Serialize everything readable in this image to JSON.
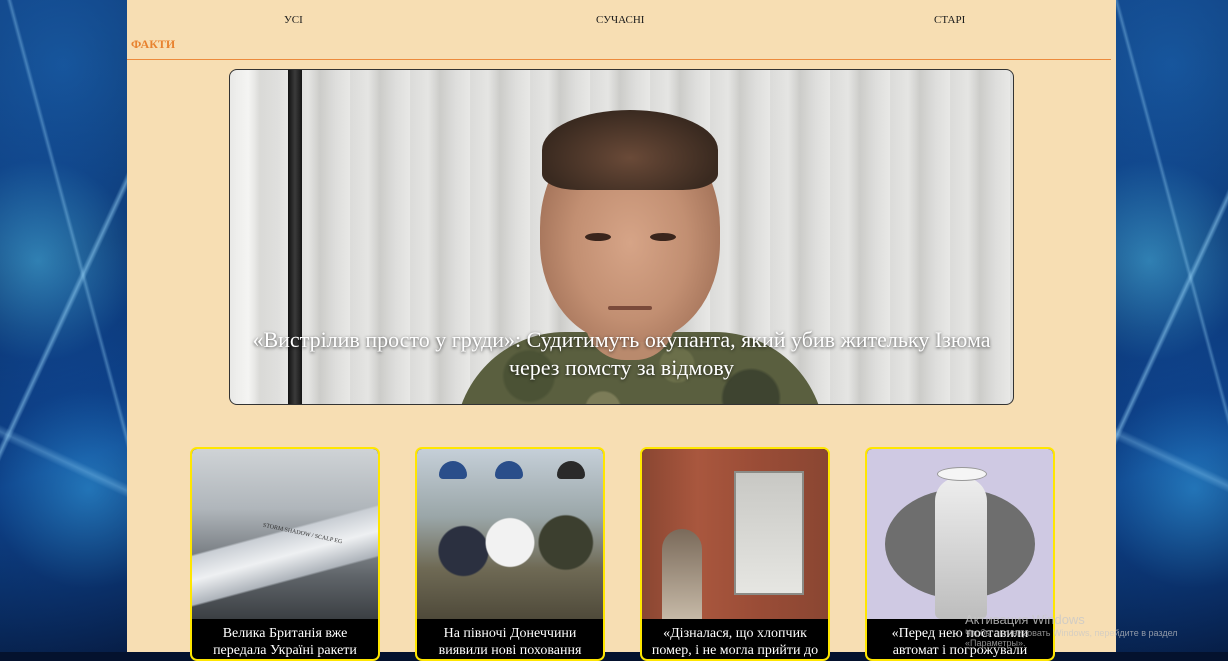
{
  "nav": {
    "all": "УСІ",
    "modern": "СУЧАСНІ",
    "old": "СТАРІ"
  },
  "section": {
    "title": "ФАКТИ"
  },
  "hero": {
    "caption": "«Вистрілив просто у груди»: Судитимуть окупанта, який убив жительку Ізюма через помсту за відмову"
  },
  "cards": [
    {
      "title": "Велика Британія вже передала Україні ракети",
      "image_label": "STORM SHADOW / SCALP EG"
    },
    {
      "title": "На півночі Донеччини виявили нові поховання"
    },
    {
      "title": "«Дізналася, що хлопчик помер, і не могла прийти до"
    },
    {
      "title": "«Перед нею поставили автомат і погрожували"
    }
  ],
  "watermark": {
    "title": "Активация Windows",
    "subtitle": "Чтобы активировать Windows, перейдите в раздел «Параметры»."
  },
  "colors": {
    "accent": "#e8822f",
    "page_bg": "#f7deb3",
    "card_border": "#ffe600"
  }
}
